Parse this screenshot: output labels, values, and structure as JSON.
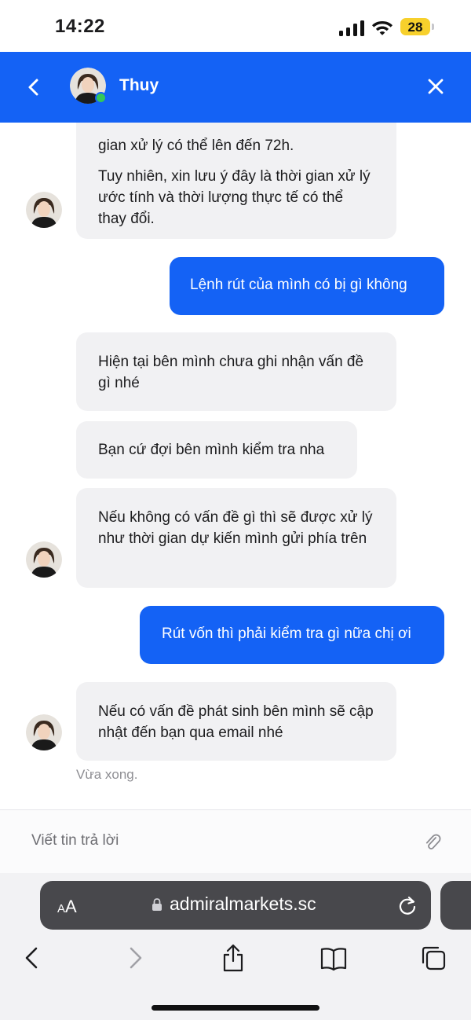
{
  "status_bar": {
    "time": "14:22",
    "battery_level": "28",
    "battery_color": "#f7d02c"
  },
  "chat_header": {
    "background_color": "#1462f5",
    "agent_name": "Thuy",
    "online_status_color": "#34c759",
    "back_icon": "chevron-left-icon",
    "close_icon": "close-icon"
  },
  "messages": [
    {
      "sender": "agent",
      "paragraphs": [
        "gian xử lý có thể lên đến 72h.",
        "Tuy nhiên, xin lưu ý đây là thời gian xử lý ước tính và thời lượng thực tế có thể thay đổi."
      ]
    },
    {
      "sender": "user",
      "text": "Lệnh rút của mình có bị gì không"
    },
    {
      "sender": "agent",
      "text": "Hiện tại bên mình chưa ghi nhận vấn đề gì nhé"
    },
    {
      "sender": "agent",
      "text": "Bạn cứ đợi bên mình kiểm tra nha"
    },
    {
      "sender": "agent",
      "text": "Nếu không có vấn đề gì thì sẽ được xử lý như thời gian dự kiến mình gửi phía trên"
    },
    {
      "sender": "user",
      "text": "Rút vốn thì phải kiểm tra gì nữa chị ơi"
    },
    {
      "sender": "agent",
      "text": "Nếu có vấn đề phát sinh bên mình sẽ cập nhật đến bạn qua email nhé"
    }
  ],
  "timestamp": "Vừa xong.",
  "reply_bar": {
    "placeholder": "Viết tin trả lời",
    "attach_icon": "paperclip-icon"
  },
  "browser": {
    "text_size_label": "AA",
    "url": "admiralmarkets.sc",
    "toolbar_icons": [
      "back-arrow-icon",
      "forward-arrow-icon",
      "share-icon",
      "bookmarks-icon",
      "tabs-icon"
    ]
  }
}
